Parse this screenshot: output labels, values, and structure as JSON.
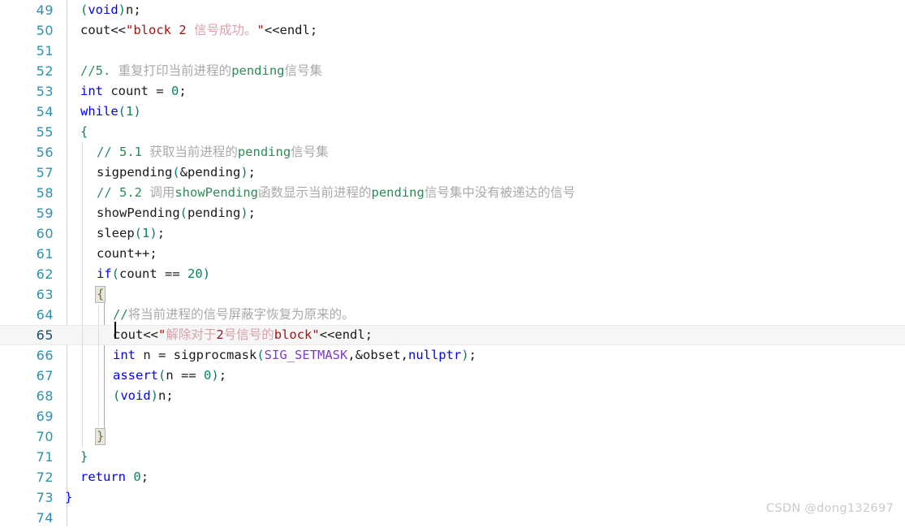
{
  "editor": {
    "language": "cpp",
    "first_line": 49,
    "last_line": 74,
    "current_line": 65,
    "colors": {
      "background": "#ffffff",
      "line_number": "#2b91af",
      "keyword": "#0000ff",
      "string": "#a31515",
      "string_cjk": "#d9a0a8",
      "comment": "#2e8b57",
      "comment_cjk": "#a9a9a9",
      "number": "#098658",
      "macro": "#7a3ec8",
      "brace": "#0b7a6b",
      "current_line_bg": "#f6f6f6",
      "gutter_separator": "#d4d4d4",
      "indent_guide": "#dcdcdc",
      "brace_match_bg": "#e4e6e0",
      "watermark": "#c9c9c9"
    },
    "lines": [
      {
        "no": "49",
        "indent": 0,
        "guides": 0,
        "tokens": [
          {
            "t": "(",
            "c": "paren"
          },
          {
            "t": "void",
            "c": "kw"
          },
          {
            "t": ")",
            "c": "paren"
          },
          {
            "t": "n;",
            "c": "punct"
          }
        ]
      },
      {
        "no": "50",
        "indent": 0,
        "guides": 0,
        "tokens": [
          {
            "t": "cout<<",
            "c": "punct"
          },
          {
            "t": "\"block 2 ",
            "c": "str"
          },
          {
            "t": "信号成功。",
            "c": "strcn"
          },
          {
            "t": "\"",
            "c": "str"
          },
          {
            "t": "<<endl;",
            "c": "punct"
          }
        ]
      },
      {
        "no": "51",
        "indent": 0,
        "guides": 0,
        "tokens": []
      },
      {
        "no": "52",
        "indent": 0,
        "guides": 0,
        "tokens": [
          {
            "t": "//5. ",
            "c": "cmt"
          },
          {
            "t": "重复打印当前进程的",
            "c": "cmtcn"
          },
          {
            "t": "pending",
            "c": "cmt"
          },
          {
            "t": "信号集",
            "c": "cmtcn"
          }
        ]
      },
      {
        "no": "53",
        "indent": 0,
        "guides": 0,
        "tokens": [
          {
            "t": "int",
            "c": "kw"
          },
          {
            "t": " count = ",
            "c": "punct"
          },
          {
            "t": "0",
            "c": "num"
          },
          {
            "t": ";",
            "c": "punct"
          }
        ]
      },
      {
        "no": "54",
        "indent": 0,
        "guides": 0,
        "tokens": [
          {
            "t": "while",
            "c": "kw"
          },
          {
            "t": "(",
            "c": "paren"
          },
          {
            "t": "1",
            "c": "num"
          },
          {
            "t": ")",
            "c": "paren"
          }
        ]
      },
      {
        "no": "55",
        "indent": 0,
        "guides": 0,
        "tokens": [
          {
            "t": "{",
            "c": "brace"
          }
        ]
      },
      {
        "no": "56",
        "indent": 1,
        "guides": 1,
        "tokens": [
          {
            "t": "// 5.1 ",
            "c": "cmt"
          },
          {
            "t": "获取当前进程的",
            "c": "cmtcn"
          },
          {
            "t": "pending",
            "c": "cmt"
          },
          {
            "t": "信号集",
            "c": "cmtcn"
          }
        ]
      },
      {
        "no": "57",
        "indent": 1,
        "guides": 1,
        "tokens": [
          {
            "t": "sigpending",
            "c": "fn"
          },
          {
            "t": "(",
            "c": "paren"
          },
          {
            "t": "&pending",
            "c": "punct"
          },
          {
            "t": ")",
            "c": "paren"
          },
          {
            "t": ";",
            "c": "punct"
          }
        ]
      },
      {
        "no": "58",
        "indent": 1,
        "guides": 1,
        "tokens": [
          {
            "t": "// 5.2 ",
            "c": "cmt"
          },
          {
            "t": "调用",
            "c": "cmtcn"
          },
          {
            "t": "showPending",
            "c": "cmt"
          },
          {
            "t": "函数显示当前进程的",
            "c": "cmtcn"
          },
          {
            "t": "pending",
            "c": "cmt"
          },
          {
            "t": "信号集中没有被递达的信号",
            "c": "cmtcn"
          }
        ]
      },
      {
        "no": "59",
        "indent": 1,
        "guides": 1,
        "tokens": [
          {
            "t": "showPending",
            "c": "fn"
          },
          {
            "t": "(",
            "c": "paren"
          },
          {
            "t": "pending",
            "c": "punct"
          },
          {
            "t": ")",
            "c": "paren"
          },
          {
            "t": ";",
            "c": "punct"
          }
        ]
      },
      {
        "no": "60",
        "indent": 1,
        "guides": 1,
        "tokens": [
          {
            "t": "sleep",
            "c": "fn"
          },
          {
            "t": "(",
            "c": "paren"
          },
          {
            "t": "1",
            "c": "num"
          },
          {
            "t": ")",
            "c": "paren"
          },
          {
            "t": ";",
            "c": "punct"
          }
        ]
      },
      {
        "no": "61",
        "indent": 1,
        "guides": 1,
        "tokens": [
          {
            "t": "count++;",
            "c": "punct"
          }
        ]
      },
      {
        "no": "62",
        "indent": 1,
        "guides": 1,
        "tokens": [
          {
            "t": "if",
            "c": "kw"
          },
          {
            "t": "(",
            "c": "paren"
          },
          {
            "t": "count == ",
            "c": "punct"
          },
          {
            "t": "20",
            "c": "num"
          },
          {
            "t": ")",
            "c": "paren"
          }
        ]
      },
      {
        "no": "63",
        "indent": 1,
        "guides": 1,
        "brace_match": "{",
        "tokens": []
      },
      {
        "no": "64",
        "indent": 2,
        "guides": 2,
        "tokens": [
          {
            "t": "//",
            "c": "cmt"
          },
          {
            "t": "将当前进程的信号屏蔽字恢复为原来的。",
            "c": "cmtcn"
          }
        ]
      },
      {
        "no": "65",
        "indent": 2,
        "guides": 2,
        "current": true,
        "tokens": [
          {
            "t": "cout<<",
            "c": "punct"
          },
          {
            "t": "\"",
            "c": "str"
          },
          {
            "t": "解除对于",
            "c": "strcn"
          },
          {
            "t": "2",
            "c": "str"
          },
          {
            "t": "号信号的",
            "c": "strcn"
          },
          {
            "t": "block",
            "c": "str"
          },
          {
            "t": "\"",
            "c": "str"
          },
          {
            "t": "<<endl;",
            "c": "punct"
          }
        ]
      },
      {
        "no": "66",
        "indent": 2,
        "guides": 2,
        "tokens": [
          {
            "t": "int",
            "c": "kw"
          },
          {
            "t": " n = ",
            "c": "punct"
          },
          {
            "t": "sigprocmask",
            "c": "fn"
          },
          {
            "t": "(",
            "c": "paren"
          },
          {
            "t": "SIG_SETMASK",
            "c": "macro"
          },
          {
            "t": ",&obset,",
            "c": "punct"
          },
          {
            "t": "nullptr",
            "c": "kw"
          },
          {
            "t": ")",
            "c": "paren"
          },
          {
            "t": ";",
            "c": "punct"
          }
        ]
      },
      {
        "no": "67",
        "indent": 2,
        "guides": 2,
        "tokens": [
          {
            "t": "assert",
            "c": "kw"
          },
          {
            "t": "(",
            "c": "paren"
          },
          {
            "t": "n == ",
            "c": "punct"
          },
          {
            "t": "0",
            "c": "num"
          },
          {
            "t": ")",
            "c": "paren"
          },
          {
            "t": ";",
            "c": "punct"
          }
        ]
      },
      {
        "no": "68",
        "indent": 2,
        "guides": 2,
        "tokens": [
          {
            "t": "(",
            "c": "paren"
          },
          {
            "t": "void",
            "c": "kw"
          },
          {
            "t": ")",
            "c": "paren"
          },
          {
            "t": "n;",
            "c": "punct"
          }
        ]
      },
      {
        "no": "69",
        "indent": 2,
        "guides": 2,
        "tokens": []
      },
      {
        "no": "70",
        "indent": 1,
        "guides": 1,
        "brace_match": "}",
        "tokens": []
      },
      {
        "no": "71",
        "indent": 0,
        "guides": 0,
        "tokens": [
          {
            "t": "}",
            "c": "brace"
          }
        ]
      },
      {
        "no": "72",
        "indent": 0,
        "guides": 0,
        "tokens": [
          {
            "t": "return",
            "c": "kw"
          },
          {
            "t": " ",
            "c": "punct"
          },
          {
            "t": "0",
            "c": "num"
          },
          {
            "t": ";",
            "c": "punct"
          }
        ]
      },
      {
        "no": "73",
        "indent": -1,
        "guides": 0,
        "tokens": [
          {
            "t": "}",
            "c": "bluebr"
          }
        ]
      },
      {
        "no": "74",
        "indent": 0,
        "guides": 0,
        "tokens": []
      }
    ]
  },
  "watermark": {
    "text": "CSDN @dong132697"
  }
}
